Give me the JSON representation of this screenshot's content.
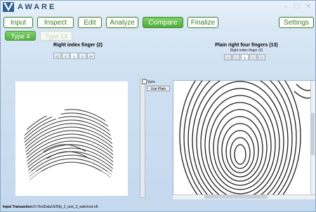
{
  "app": {
    "brand": "AWARE"
  },
  "window_controls": {
    "minimize": "–",
    "maximize": "☐",
    "close": "✕"
  },
  "tabs": [
    {
      "label": "Input",
      "state": "normal"
    },
    {
      "label": "Inspect",
      "state": "normal"
    },
    {
      "label": "Edit",
      "state": "normal"
    },
    {
      "label": "Analyze",
      "state": "normal"
    },
    {
      "label": "Compare",
      "state": "active"
    },
    {
      "label": "Finalize",
      "state": "normal"
    },
    {
      "label": "Settings",
      "state": "normal"
    }
  ],
  "subtabs": [
    {
      "label": "Type 4",
      "state": "active"
    },
    {
      "label": "Type 14",
      "state": "disabled"
    }
  ],
  "left_panel": {
    "title": "Right index finger (2)",
    "nav": {
      "first": "<<",
      "prev": "<",
      "page": "1",
      "next": ">",
      "last": ">>"
    }
  },
  "right_panel": {
    "title": "Plain right four fingers (13)",
    "subtitle": "Right index finger (2)",
    "nav": {
      "first": "<<",
      "prev": "<",
      "page": "1",
      "next": ">",
      "last": ">>"
    }
  },
  "middle": {
    "sync_label": "Sync",
    "use_plain_label": "Use Plain"
  },
  "status_bar": {
    "label": "Input Transaction:",
    "path": "D:\\TestData\\SI5\\fp_2_and_3_switched.eft"
  },
  "colors": {
    "accent_green": "#52af3d",
    "title_blue": "#2a4e74"
  }
}
